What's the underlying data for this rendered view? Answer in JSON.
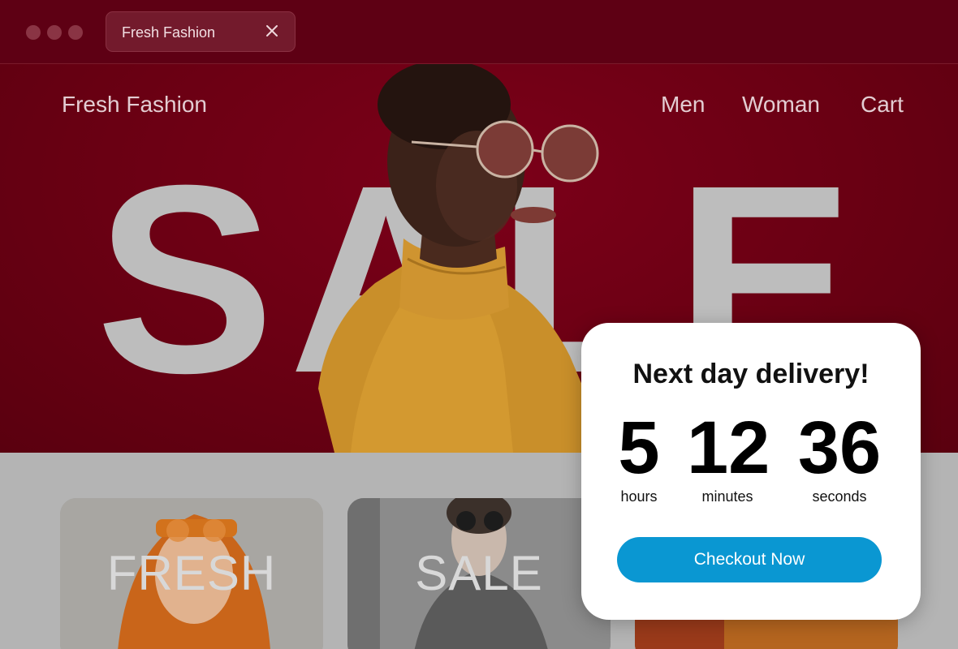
{
  "browser": {
    "tab_title": "Fresh Fashion",
    "close_icon": "close-icon"
  },
  "site": {
    "brand": "Fresh Fashion",
    "nav": [
      "Men",
      "Woman",
      "Cart"
    ],
    "hero_word": "SALE"
  },
  "cards": [
    {
      "label": "FRESH"
    },
    {
      "label": "SALE"
    }
  ],
  "popup": {
    "title": "Next day delivery!",
    "countdown": [
      {
        "value": "5",
        "unit": "hours"
      },
      {
        "value": "12",
        "unit": "minutes"
      },
      {
        "value": "36",
        "unit": "seconds"
      }
    ],
    "cta_label": "Checkout Now"
  },
  "colors": {
    "hero_bg": "#6a0013",
    "chrome_bg": "#5e0014",
    "accent": "#0a97d2"
  }
}
